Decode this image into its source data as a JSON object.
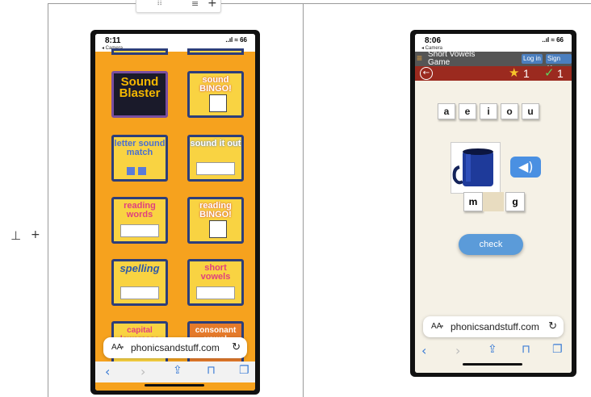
{
  "doc": {
    "toolbar_plus": "+",
    "row_add": "+"
  },
  "left_phone": {
    "time": "8:11",
    "back_label": "◂ Camera",
    "signal": "..ıl ≈ 66",
    "tiles": [
      {
        "title": "Sound Blaster",
        "bg": "#1a1a2a",
        "fg": "#f5b800"
      },
      {
        "title": "sound BINGO!",
        "bg": "#f9d342",
        "fg": "#ffffff"
      },
      {
        "title": "letter sound match",
        "bg": "#f9d342",
        "fg": "#4a6fd1"
      },
      {
        "title": "sound it out",
        "bg": "#f9d342",
        "fg": "#ffffff"
      },
      {
        "title": "reading words",
        "bg": "#f9d342",
        "fg": "#e0407e"
      },
      {
        "title": "reading BINGO!",
        "bg": "#f9d342",
        "fg": "#ffffff"
      },
      {
        "title": "spelling",
        "bg": "#f9d342",
        "fg": "#2e5aa8"
      },
      {
        "title": "short vowels",
        "bg": "#f9d342",
        "fg": "#e0407e"
      },
      {
        "title": "capital lowercase",
        "bg": "#f9d342",
        "fg": "#e0407e"
      },
      {
        "title": "consonant vowel",
        "bg": "#e57a2a",
        "fg": "#ffffff"
      }
    ],
    "url": "phonicsandstuff.com",
    "aa": "AA"
  },
  "right_phone": {
    "time": "8:06",
    "back_label": "◂ Camera",
    "signal": "..ıl ≈ 66",
    "game_title": "Short Vowels Game",
    "login": "Log in",
    "signup": "Sign Up",
    "stars": "1",
    "checks": "1",
    "vowels": [
      "a",
      "e",
      "i",
      "o",
      "u"
    ],
    "word_start": "m",
    "word_end": "g",
    "check_label": "check",
    "url": "phonicsandstuff.com",
    "aa": "AA"
  }
}
